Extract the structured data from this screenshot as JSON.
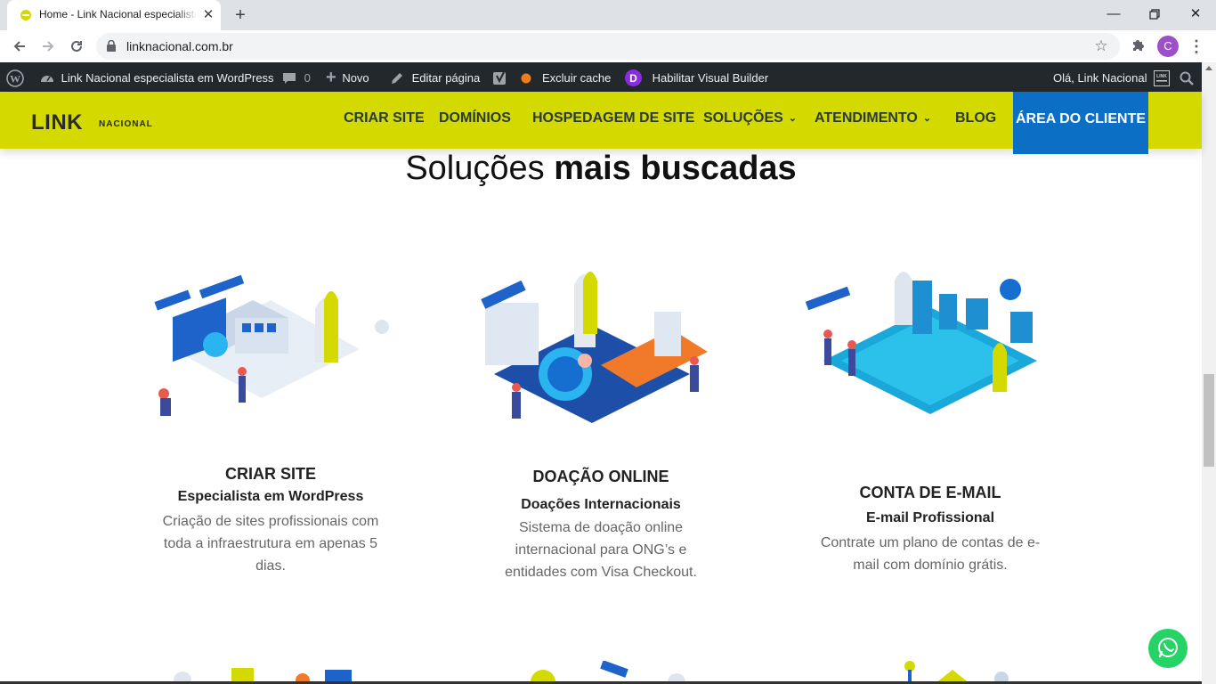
{
  "browser": {
    "tab_title": "Home - Link Nacional especialista em WordPress",
    "url": "linknacional.com.br",
    "profile_initial": "C"
  },
  "adminbar": {
    "site_name": "Link Nacional especialista em WordPress",
    "comments_count": "0",
    "new_label": "Novo",
    "edit_label": "Editar página",
    "cache_label": "Excluir cache",
    "visual_builder_label": "Habilitar Visual Builder",
    "greeting": "Olá, Link Nacional"
  },
  "header": {
    "logo_main": "LINK",
    "logo_sub": "NACIONAL",
    "nav": [
      {
        "label": "CRIAR SITE"
      },
      {
        "label": "DOMÍNIOS"
      },
      {
        "label": "HOSPEDAGEM DE SITE"
      },
      {
        "label": "SOLUÇÕES"
      },
      {
        "label": "ATENDIMENTO"
      },
      {
        "label": "BLOG"
      }
    ],
    "client_area": "ÁREA DO CLIENTE",
    "brand_color": "#d4d900",
    "client_color": "#0b6fc5"
  },
  "section": {
    "title_light": "Soluções",
    "title_bold": "mais buscadas"
  },
  "cards": [
    {
      "title": "CRIAR SITE",
      "subtitle": "Especialista em WordPress",
      "desc": [
        "Criação de sites profissionais com",
        "toda a infraestrutura em apenas 5",
        "dias."
      ]
    },
    {
      "title": "DOAÇÃO ONLINE",
      "subtitle": "Doações Internacionais",
      "desc": [
        "Sistema de doação online",
        "internacional para ONG’s e",
        "entidades com Visa Checkout."
      ]
    },
    {
      "title": "CONTA DE E-MAIL",
      "subtitle": "E-mail Profissional",
      "desc": [
        "Contrate um plano de contas de e-",
        "mail com domínio grátis."
      ]
    }
  ],
  "icons": {
    "favicon": "link-nacional-favicon",
    "whatsapp": "whatsapp-icon"
  }
}
